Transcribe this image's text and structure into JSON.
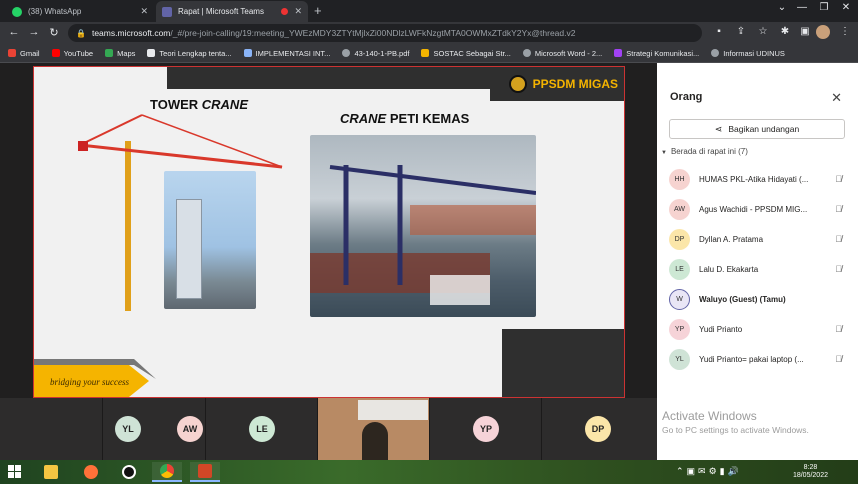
{
  "browser": {
    "tabs": [
      {
        "label": "(38) WhatsApp",
        "favicon_color": "#25d366",
        "active": false
      },
      {
        "label": "Rapat | Microsoft Teams",
        "favicon_color": "#6264a7",
        "active": true
      }
    ],
    "new_tab_glyph": "+",
    "url_host": "teams.microsoft.com",
    "url_path": "/_#/pre-join-calling/19:meeting_YWEzMDY3ZTYtMjlxZi00NDlzLWFkNzgtMTA0OWMxZTdkY2Yx@thread.v2",
    "bookmarks": [
      {
        "label": "Gmail",
        "color": "#ea4335"
      },
      {
        "label": "YouTube",
        "color": "#ff0000"
      },
      {
        "label": "Maps",
        "color": "#34a853"
      },
      {
        "label": "Teori Lengkap tenta...",
        "color": "#e8eaed"
      },
      {
        "label": "IMPLEMENTASI INT...",
        "color": "#8ab4f8"
      },
      {
        "label": "43-140-1-PB.pdf",
        "color": "#9aa0a6"
      },
      {
        "label": "SOSTAC Sebagai Str...",
        "color": "#f4b400"
      },
      {
        "label": "Microsoft Word - 2...",
        "color": "#9aa0a6"
      },
      {
        "label": "Strategi Komunikasi...",
        "color": "#a142f4"
      },
      {
        "label": "Informasi UDINUS",
        "color": "#9aa0a6"
      }
    ]
  },
  "slide": {
    "brand": "PPSDM MIGAS",
    "title_left_plain": "TOWER ",
    "title_left_italic": "CRANE",
    "title_right_italic": "CRANE",
    "title_right_plain": " PETI KEMAS",
    "tagline": "bridging your success",
    "accent_color": "#f5b400"
  },
  "stage_participants": [
    {
      "initials": "YL",
      "color": "#cfe3d6"
    },
    {
      "initials": "AW",
      "color": "#f6d3d0"
    },
    {
      "initials": "LE",
      "color": "#cde8d4"
    },
    {
      "initials": "",
      "color": "#b88a64",
      "video": true
    },
    {
      "initials": "YP",
      "color": "#f6d3d8"
    },
    {
      "initials": "DP",
      "color": "#fbe6a9"
    }
  ],
  "panel": {
    "title": "Orang",
    "share_label": "Bagikan undangan",
    "section_label": "Berada di rapat ini (7)",
    "participants": [
      {
        "initials": "HH",
        "name": "HUMAS PKL-Atika Hidayati (...",
        "color": "#f6d3d0",
        "bold": false,
        "muted": true
      },
      {
        "initials": "AW",
        "name": "Agus Wachidi - PPSDM MIG...",
        "color": "#f6d3d0",
        "bold": false,
        "muted": true
      },
      {
        "initials": "DP",
        "name": "Dyllan A. Pratama",
        "color": "#fbe6a9",
        "bold": false,
        "muted": true
      },
      {
        "initials": "LE",
        "name": "Lalu D. Ekakarta",
        "color": "#cde8d4",
        "bold": false,
        "muted": true
      },
      {
        "initials": "W",
        "name": "Waluyo (Guest) (Tamu)",
        "color": "#e9e6f6",
        "bold": true,
        "muted": false
      },
      {
        "initials": "YP",
        "name": "Yudi Prianto",
        "color": "#f6d3d8",
        "bold": false,
        "muted": true
      },
      {
        "initials": "YL",
        "name": "Yudi Prianto= pakai laptop (...",
        "color": "#cfe3d6",
        "bold": false,
        "muted": true
      }
    ]
  },
  "watermark": {
    "line1": "Activate Windows",
    "line2": "Go to PC settings to activate Windows."
  },
  "taskbar": {
    "time": "8:28",
    "date": "18/05/2022"
  }
}
